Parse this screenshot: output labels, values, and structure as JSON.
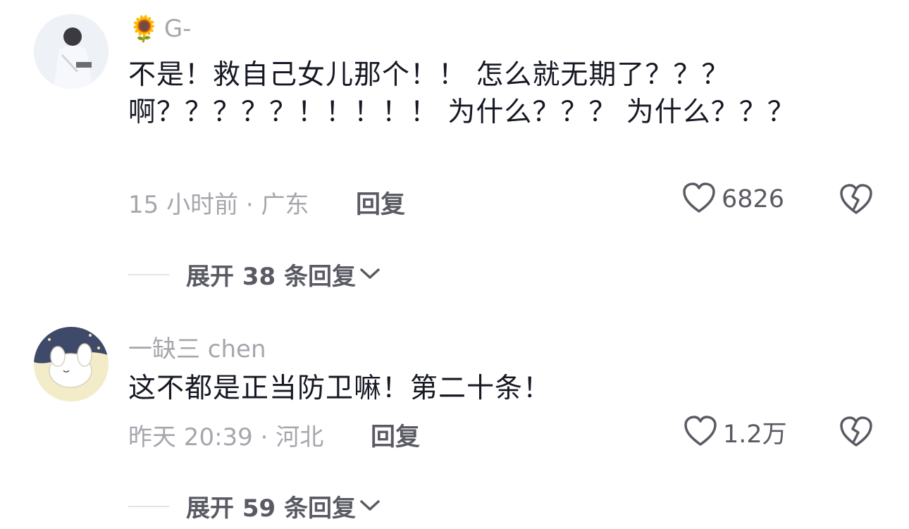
{
  "comments": [
    {
      "username": "G-",
      "username_emoji": "🌻",
      "text": "不是！救自己女儿那个！！ 怎么就无期了？？？啊？？？？？！！！！！ 为什么？？？ 为什么？？？",
      "time_location": "15 小时前 · 广东",
      "reply_label": "回复",
      "like_count": "6826",
      "expand_label": "展开 38 条回复"
    },
    {
      "username": "一缺三 chen",
      "text": "这不都是正当防卫嘛！第二十条！",
      "time_location": "昨天 20:39 · 河北",
      "reply_label": "回复",
      "like_count": "1.2万",
      "expand_label": "展开 59 条回复"
    }
  ],
  "colors": {
    "primary_text": "#161823",
    "secondary_text": "#a6a6ad",
    "action_text": "#5a5a64"
  }
}
